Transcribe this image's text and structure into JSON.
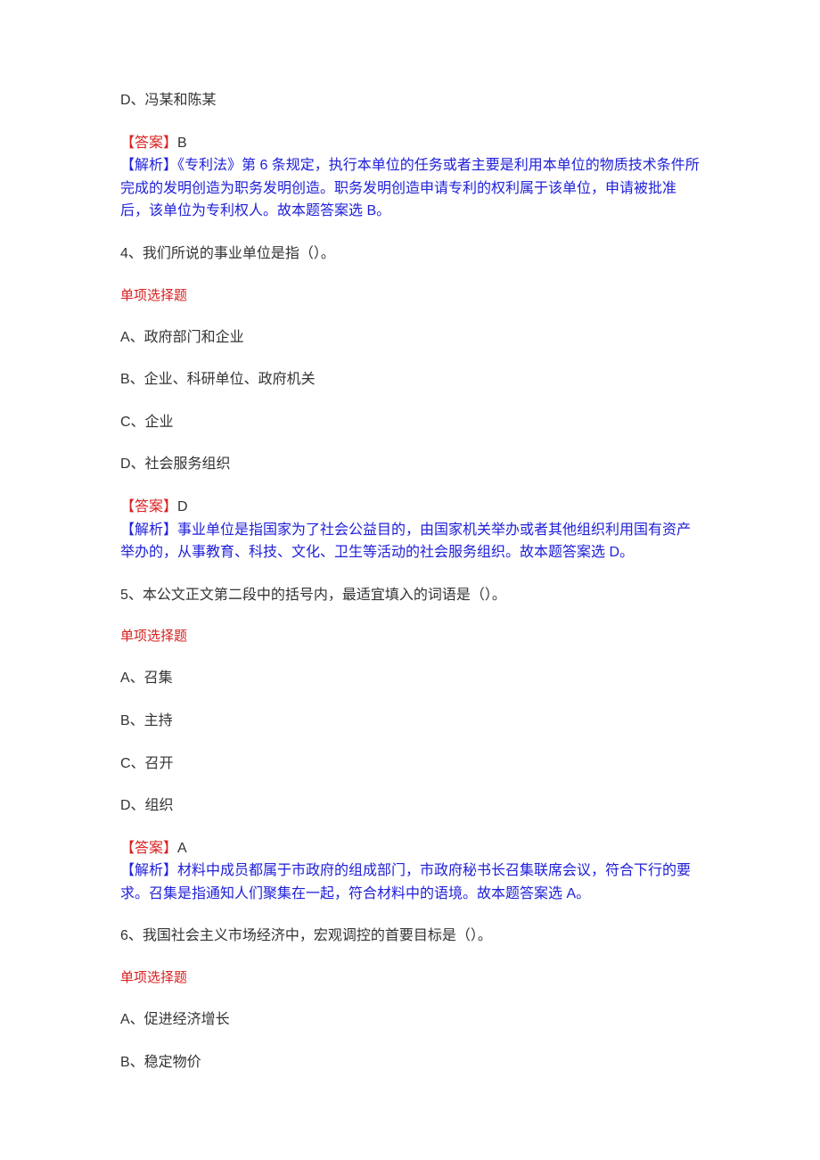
{
  "q3": {
    "optionD": "D、冯某和陈某",
    "answerLabel": "【答案】",
    "answerValue": "B",
    "analysisLabel": "【解析】",
    "analysisText": "《专利法》第 6 条规定，执行本单位的任务或者主要是利用本单位的物质技术条件所完成的发明创造为职务发明创造。职务发明创造申请专利的权利属于该单位，申请被批准后，该单位为专利权人。故本题答案选 B。"
  },
  "q4": {
    "stem": "4、我们所说的事业单位是指（）。",
    "type": "单项选择题",
    "optionA": "A、政府部门和企业",
    "optionB": "B、企业、科研单位、政府机关",
    "optionC": "C、企业",
    "optionD": "D、社会服务组织",
    "answerLabel": "【答案】",
    "answerValue": "D",
    "analysisLabel": "【解析】",
    "analysisText": "事业单位是指国家为了社会公益目的，由国家机关举办或者其他组织利用国有资产举办的，从事教育、科技、文化、卫生等活动的社会服务组织。故本题答案选 D。"
  },
  "q5": {
    "stem": "5、本公文正文第二段中的括号内，最适宜填入的词语是（）。",
    "type": "单项选择题",
    "optionA": "A、召集",
    "optionB": "B、主持",
    "optionC": "C、召开",
    "optionD": "D、组织",
    "answerLabel": "【答案】",
    "answerValue": "A",
    "analysisLabel": "【解析】",
    "analysisText": "材料中成员都属于市政府的组成部门，市政府秘书长召集联席会议，符合下行的要求。召集是指通知人们聚集在一起，符合材料中的语境。故本题答案选 A。"
  },
  "q6": {
    "stem": "6、我国社会主义市场经济中，宏观调控的首要目标是（）。",
    "type": "单项选择题",
    "optionA": "A、促进经济增长",
    "optionB": "B、稳定物价"
  }
}
